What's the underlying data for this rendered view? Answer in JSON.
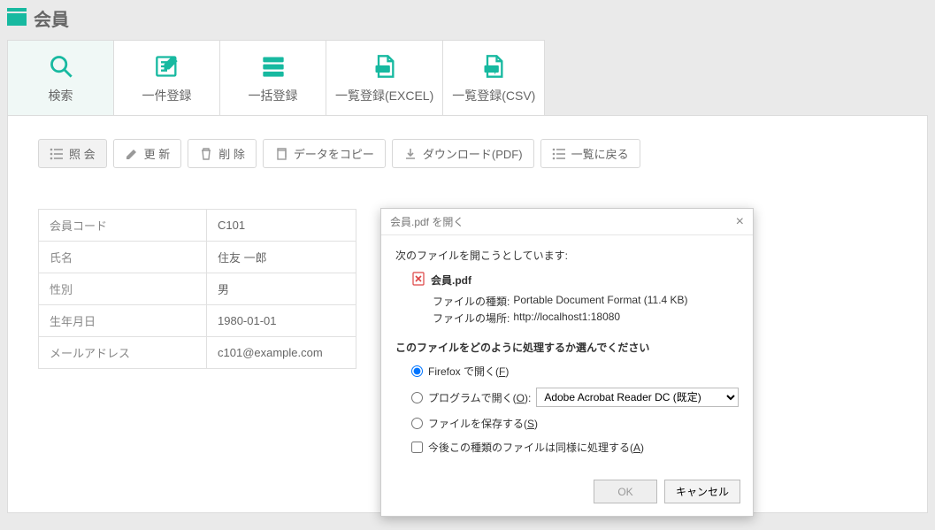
{
  "header": {
    "title": "会員"
  },
  "tabs": [
    {
      "label": "検索"
    },
    {
      "label": "一件登録"
    },
    {
      "label": "一括登録"
    },
    {
      "label": "一覧登録(EXCEL)"
    },
    {
      "label": "一覧登録(CSV)"
    }
  ],
  "toolbar": {
    "shokai": "照 会",
    "koushin": "更 新",
    "sakujo": "削 除",
    "copy": "データをコピー",
    "download": "ダウンロード(PDF)",
    "back": "一覧に戻る"
  },
  "details": {
    "rows": [
      {
        "th": "会員コード",
        "td": "C101"
      },
      {
        "th": "氏名",
        "td": "住友 一郎"
      },
      {
        "th": "性別",
        "td": "男"
      },
      {
        "th": "生年月日",
        "td": "1980-01-01"
      },
      {
        "th": "メールアドレス",
        "td": "c101@example.com"
      }
    ]
  },
  "dialog": {
    "title": "会員.pdf を開く",
    "intro": "次のファイルを開こうとしています:",
    "filename": "会員.pdf",
    "filetype_label": "ファイルの種類:",
    "filetype_value": "Portable Document Format (11.4 KB)",
    "filesrc_label": "ファイルの場所:",
    "filesrc_value": "http://localhost1:18080",
    "question": "このファイルをどのように処理するか選んでください",
    "opt_firefox_pre": "Firefox で開く(",
    "opt_firefox_key": "F",
    "opt_firefox_post": ")",
    "opt_prog_pre": "プログラムで開く(",
    "opt_prog_key": "O",
    "opt_prog_post": "):",
    "opt_prog_app": "Adobe Acrobat Reader DC (既定)",
    "opt_save_pre": "ファイルを保存する(",
    "opt_save_key": "S",
    "opt_save_post": ")",
    "remember_pre": "今後この種類のファイルは同様に処理する(",
    "remember_key": "A",
    "remember_post": ")",
    "ok": "OK",
    "cancel": "キャンセル"
  }
}
